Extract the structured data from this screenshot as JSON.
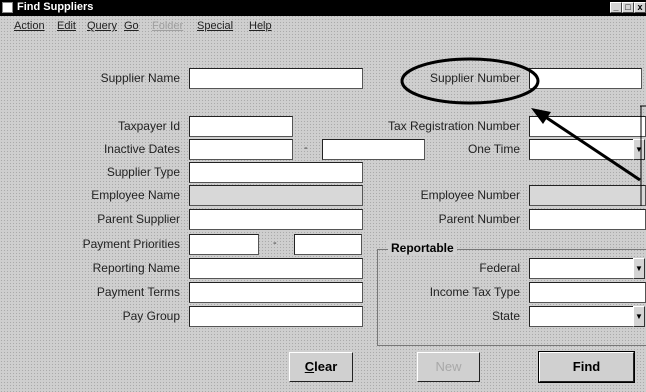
{
  "window": {
    "title": "Find Suppliers",
    "controls": [
      "_",
      "□",
      "x"
    ]
  },
  "menubar": {
    "items": [
      {
        "label": "Action",
        "enabled": true
      },
      {
        "label": "Edit",
        "enabled": true
      },
      {
        "label": "Query",
        "enabled": true
      },
      {
        "label": "Go",
        "enabled": true
      },
      {
        "label": "Folder",
        "enabled": false
      },
      {
        "label": "Special",
        "enabled": true
      },
      {
        "label": "Help",
        "enabled": true
      }
    ]
  },
  "form": {
    "supplier_name": {
      "label": "Supplier Name",
      "value": ""
    },
    "supplier_number": {
      "label": "Supplier Number",
      "value": ""
    },
    "taxpayer_id": {
      "label": "Taxpayer Id",
      "value": ""
    },
    "tax_registration_number": {
      "label": "Tax Registration Number",
      "value": ""
    },
    "inactive_dates": {
      "label": "Inactive Dates",
      "from": "",
      "separator": "-",
      "to": ""
    },
    "one_time": {
      "label": "One Time",
      "value": ""
    },
    "supplier_type": {
      "label": "Supplier Type",
      "value": ""
    },
    "employee_name": {
      "label": "Employee Name",
      "value": ""
    },
    "employee_number": {
      "label": "Employee Number",
      "value": ""
    },
    "parent_supplier": {
      "label": "Parent Supplier",
      "value": ""
    },
    "parent_number": {
      "label": "Parent Number",
      "value": ""
    },
    "payment_priorities": {
      "label": "Payment Priorities",
      "from": "",
      "separator": "-",
      "to": ""
    },
    "reporting_name": {
      "label": "Reporting Name",
      "value": ""
    },
    "payment_terms": {
      "label": "Payment Terms",
      "value": ""
    },
    "pay_group": {
      "label": "Pay Group",
      "value": ""
    },
    "reportable": {
      "title": "Reportable",
      "federal": {
        "label": "Federal",
        "value": ""
      },
      "income_tax_type": {
        "label": "Income Tax Type",
        "value": ""
      },
      "state": {
        "label": "State",
        "value": ""
      }
    }
  },
  "buttons": {
    "clear": {
      "label": "Clear",
      "mnemonic": "C",
      "rest": "lear"
    },
    "new": {
      "label": "New",
      "enabled": false
    },
    "find": {
      "label": "Find",
      "default": true
    }
  },
  "annotation": {
    "ellipse_color": "#000000",
    "arrow_color": "#000000"
  },
  "icons": [
    "app-icon",
    "minimize-icon",
    "maximize-icon",
    "close-icon",
    "dropdown-arrow-icon"
  ]
}
